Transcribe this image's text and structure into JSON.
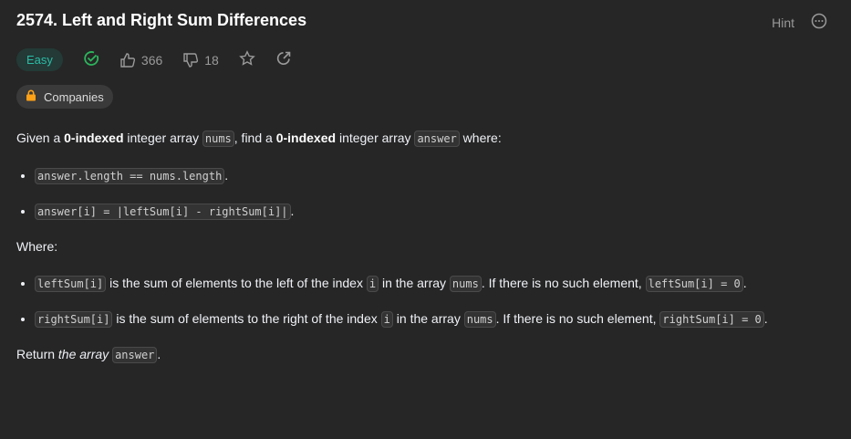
{
  "title": "2574. Left and Right Sum Differences",
  "hint": "Hint",
  "difficulty": "Easy",
  "likes": "366",
  "dislikes": "18",
  "companies": "Companies",
  "colors": {
    "easy": "#2cbba6",
    "solved": "#2db55d",
    "lock": "#ffa116",
    "background": "#262626"
  },
  "desc": {
    "p1": [
      "Given a ",
      "0-indexed",
      " integer array ",
      "nums",
      ", find a ",
      "0-indexed",
      " integer array ",
      "answer",
      " where:"
    ],
    "b1": [
      "answer.length == nums.length",
      "."
    ],
    "b2": [
      "answer[i] = |leftSum[i] - rightSum[i]|",
      "."
    ],
    "where": "Where:",
    "b3": [
      "leftSum[i]",
      " is the sum of elements to the left of the index ",
      "i",
      " in the array ",
      "nums",
      ". If there is no such element, ",
      "leftSum[i] = 0",
      "."
    ],
    "b4": [
      "rightSum[i]",
      " is the sum of elements to the right of the index ",
      "i",
      " in the array ",
      "nums",
      ". If there is no such element, ",
      "rightSum[i] = 0",
      "."
    ],
    "ret": [
      "Return ",
      "the array",
      " ",
      "answer",
      "."
    ]
  }
}
